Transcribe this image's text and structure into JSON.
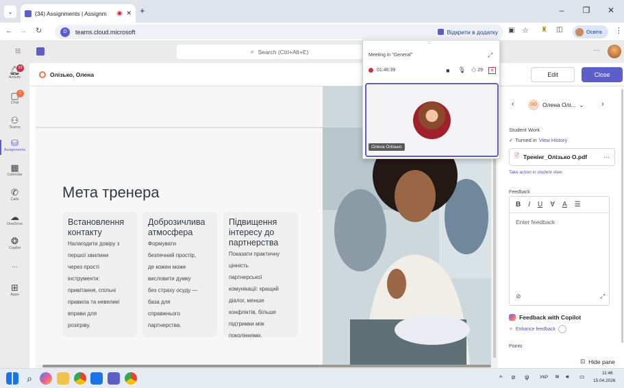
{
  "browser": {
    "tab_title": "(34) Assignments | Assignm",
    "new_tab": "+",
    "url": "teams.cloud.microsoft",
    "open_in_app": "Відкрити в додатку",
    "profile_label": "Освіта",
    "win_min": "–",
    "win_max": "❐",
    "win_close": "✕"
  },
  "teams": {
    "search_placeholder": "Search (Ctrl+Alt+E)",
    "more": "···",
    "rail": [
      {
        "label": "Activity",
        "badge": "33"
      },
      {
        "label": "Chat",
        "badge": "1"
      },
      {
        "label": "Teams"
      },
      {
        "label": "Assignments"
      },
      {
        "label": "Calendar"
      },
      {
        "label": "Calls"
      },
      {
        "label": "OneDrive"
      },
      {
        "label": "Copilot"
      },
      {
        "label": "..."
      },
      {
        "label": "Apps"
      }
    ],
    "student_name": "Олізько, Олена",
    "edit": "Edit",
    "close": "Close"
  },
  "slide": {
    "title": "Мета тренера",
    "cards": [
      {
        "heading": "Встановлення контакту",
        "body": [
          "Налагодити довіру з",
          "першої хвилини",
          "через прості",
          "інструменти:",
          "привітання, спільні",
          "правила та невеликі",
          "вправи для",
          "розігріву."
        ]
      },
      {
        "heading": "Доброзичлива атмосфера",
        "body": [
          "Формувати",
          "безпечний простір,",
          "де кожен може",
          "висловити думку",
          "без страху осуду —",
          "база для",
          "справжнього",
          "партнерства."
        ]
      },
      {
        "heading": "Підвищення інтересу до партнерства",
        "body": [
          "Показати практичну",
          "цінність",
          "партнерської",
          "комунікації: кращий",
          "діалог, менше",
          "конфліктів, більше",
          "підтримки між",
          "поколіннями."
        ]
      }
    ]
  },
  "meeting": {
    "title": "Meeting in \"General\"",
    "timer": "01:46:39",
    "participants": "29",
    "participant_name": "Олена Олізько",
    "grip": ":::"
  },
  "panel": {
    "student": "Олена Олі...",
    "student_initials": "OO",
    "student_work": "Student Work",
    "turned_in": "Turned in",
    "view_history": "View History",
    "file": "Тренінг_Олізько О.pdf",
    "take_action": "Take action in student view",
    "feedback": "Feedback",
    "feedback_placeholder": "Enter feedback",
    "copilot": "Feedback with Copilot",
    "enhance": "Enhance feedback",
    "points": "Points",
    "hide_pane": "Hide pane"
  },
  "taskbar": {
    "lang": "УКР",
    "time": "11:46",
    "date": "15.04.2026"
  },
  "colors": {
    "accent": "#5b5fc7",
    "badge": "#c4314b",
    "title_bar": "#dfe3eb"
  }
}
